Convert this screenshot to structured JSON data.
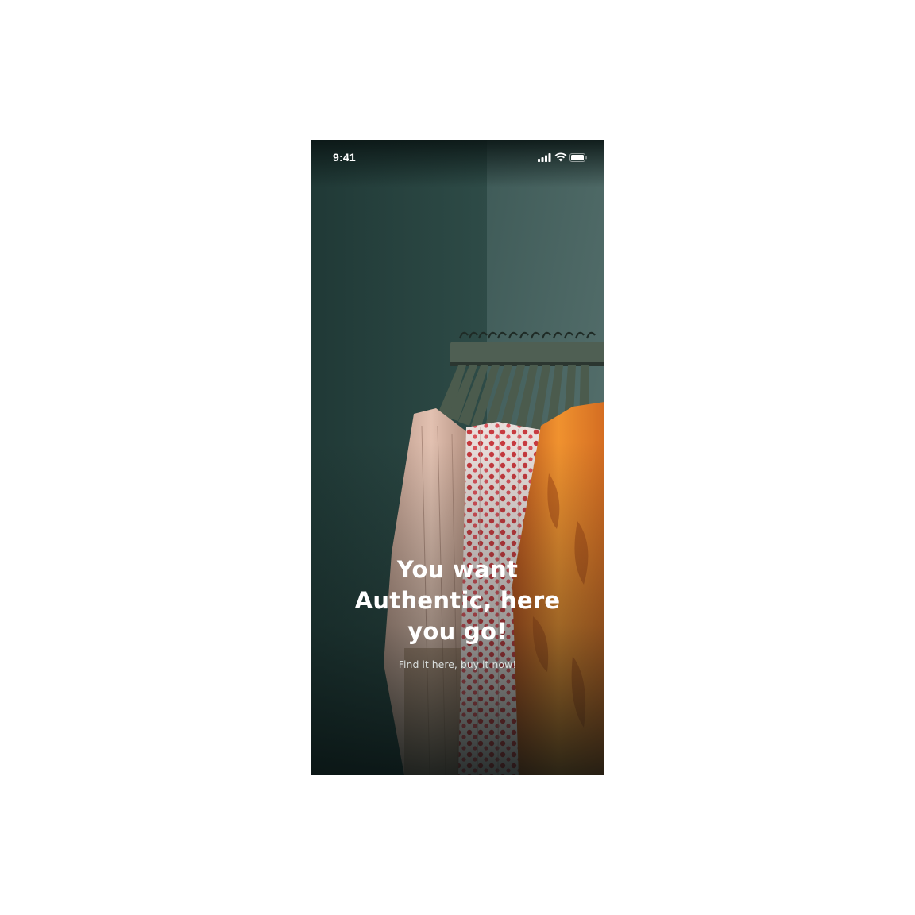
{
  "status_bar": {
    "time": "9:41",
    "icons": [
      "cellular-signal-icon",
      "wifi-icon",
      "battery-icon"
    ]
  },
  "hero": {
    "image": "clothing-rack-photo",
    "headline": "You want Authentic, here you go!",
    "subline": "Find it here, buy it now!"
  },
  "colors": {
    "wall": "#2f4744",
    "text": "#ffffff",
    "accent_orange": "#e0782a",
    "accent_red": "#c9343c"
  }
}
